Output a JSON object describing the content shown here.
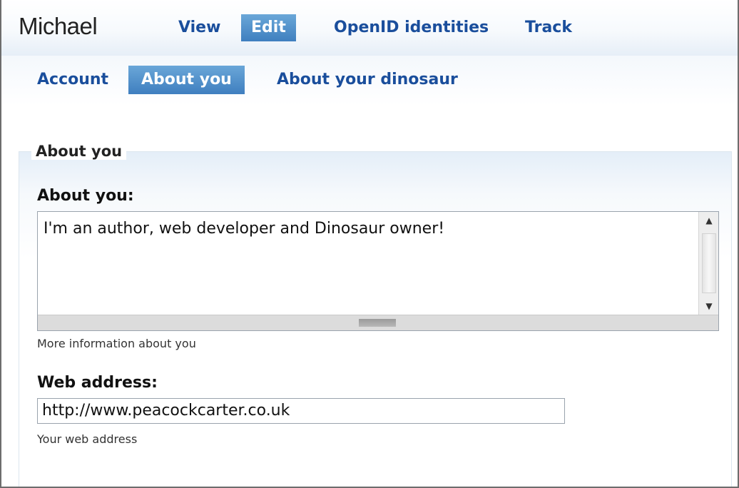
{
  "header": {
    "user_name": "Michael",
    "primary_tabs": [
      {
        "label": "View",
        "active": false
      },
      {
        "label": "Edit",
        "active": true
      },
      {
        "label": "OpenID identities",
        "active": false
      },
      {
        "label": "Track",
        "active": false
      }
    ]
  },
  "subnav": {
    "tabs": [
      {
        "label": "Account",
        "active": false
      },
      {
        "label": "About you",
        "active": true
      },
      {
        "label": "About your dinosaur",
        "active": false
      }
    ]
  },
  "form": {
    "legend": "About you",
    "about": {
      "label": "About you:",
      "value": "I'm an author, web developer and Dinosaur owner!",
      "help": "More information about you"
    },
    "web_address": {
      "label": "Web address:",
      "value": "http://www.peacockcarter.co.uk",
      "help": "Your web address"
    }
  },
  "colors": {
    "tab_link": "#1a4e9c",
    "tab_active_bg": "#4f8fcc",
    "tab_active_text": "#ffffff"
  }
}
